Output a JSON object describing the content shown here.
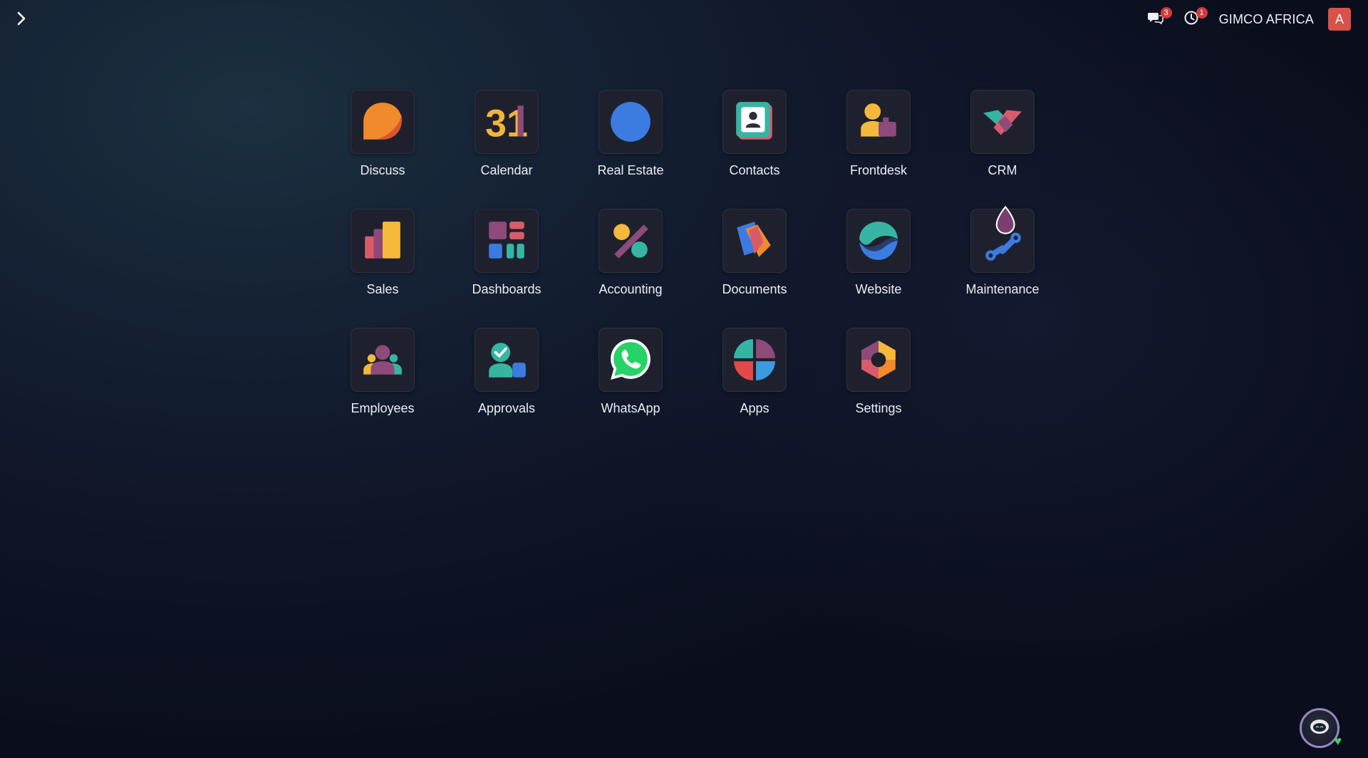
{
  "sidebar_toggle": {
    "icon": "chevron-right-icon"
  },
  "systray": {
    "messages": {
      "icon": "chat-bubbles-icon",
      "count": "3"
    },
    "activities": {
      "icon": "clock-icon",
      "count": "1"
    },
    "company_name": "GIMCO AFRICA",
    "user_avatar_letter": "A",
    "avatar_color": "#d8524a"
  },
  "apps": [
    {
      "label": "Discuss",
      "icon": "discuss-icon"
    },
    {
      "label": "Calendar",
      "icon": "calendar-icon"
    },
    {
      "label": "Real Estate",
      "icon": "real-estate-icon"
    },
    {
      "label": "Contacts",
      "icon": "contacts-icon"
    },
    {
      "label": "Frontdesk",
      "icon": "frontdesk-icon"
    },
    {
      "label": "CRM",
      "icon": "crm-icon"
    },
    {
      "label": "Sales",
      "icon": "sales-icon"
    },
    {
      "label": "Dashboards",
      "icon": "dashboards-icon"
    },
    {
      "label": "Accounting",
      "icon": "accounting-icon"
    },
    {
      "label": "Documents",
      "icon": "documents-icon"
    },
    {
      "label": "Website",
      "icon": "website-icon"
    },
    {
      "label": "Maintenance",
      "icon": "maintenance-icon"
    },
    {
      "label": "Employees",
      "icon": "employees-icon"
    },
    {
      "label": "Approvals",
      "icon": "approvals-icon"
    },
    {
      "label": "WhatsApp",
      "icon": "whatsapp-icon"
    },
    {
      "label": "Apps",
      "icon": "apps-icon"
    },
    {
      "label": "Settings",
      "icon": "settings-icon"
    }
  ],
  "calendar_icon_text": "31",
  "assistant_button": {
    "icon": "chatbot-icon",
    "status_icon": "heart-icon"
  },
  "colors": {
    "orange": "#f08a2c",
    "purple": "#8d4a7a",
    "teal": "#36b5a4",
    "blue": "#3c7be0",
    "yellow": "#f4b93a",
    "red": "#e24a4a"
  }
}
